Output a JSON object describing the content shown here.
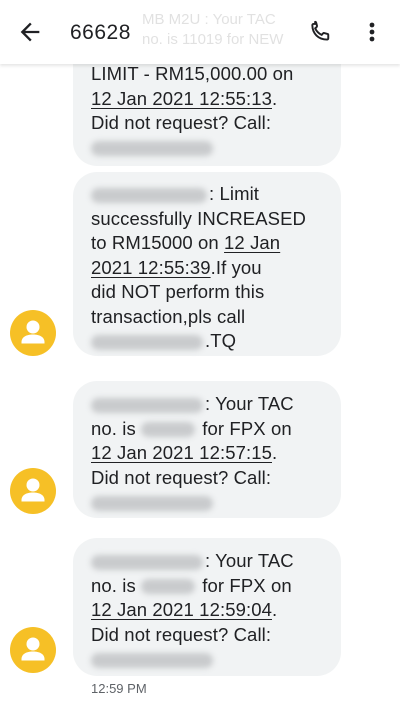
{
  "header": {
    "title": "66628",
    "preview_snippet_line1": "MB M2U : Your TAC",
    "preview_snippet_line2": "no. is 11019 for NEW"
  },
  "icons": {
    "back": "arrow-back-icon",
    "call": "phone-icon",
    "more": "more-vert-icon",
    "avatar": "person-icon"
  },
  "colors": {
    "avatar": "#f6c026",
    "bubble": "#f1f3f4",
    "text": "#202124",
    "timestamp": "#5f6368"
  },
  "messages": [
    {
      "line1": "LIMIT - RM15,000.00 on",
      "date": "12 Jan 2021 12:55:13",
      "date_suffix": ".",
      "line3": "Did not request? Call:"
    },
    {
      "line1_suffix": ": Limit",
      "line2": "successfully INCREASED",
      "line3_prefix": "to RM15000 on ",
      "date_part1": "12 Jan",
      "date_part2": "2021 12:55:39",
      "line4_suffix": ".If you",
      "line5": "did NOT perform this",
      "line6": "transaction,pls call",
      "line7_suffix": ".TQ"
    },
    {
      "line1_suffix": ": Your TAC",
      "line2_prefix": "no. is ",
      "line2_suffix": " for FPX on",
      "date": "12 Jan 2021 12:57:15",
      "date_suffix": ".",
      "line4": "Did not request? Call:"
    },
    {
      "line1_suffix": ": Your TAC",
      "line2_prefix": "no. is ",
      "line2_suffix": " for FPX on",
      "date": "12 Jan 2021 12:59:04",
      "date_suffix": ".",
      "line4": "Did not request? Call:"
    }
  ],
  "timestamp": "12:59 PM"
}
